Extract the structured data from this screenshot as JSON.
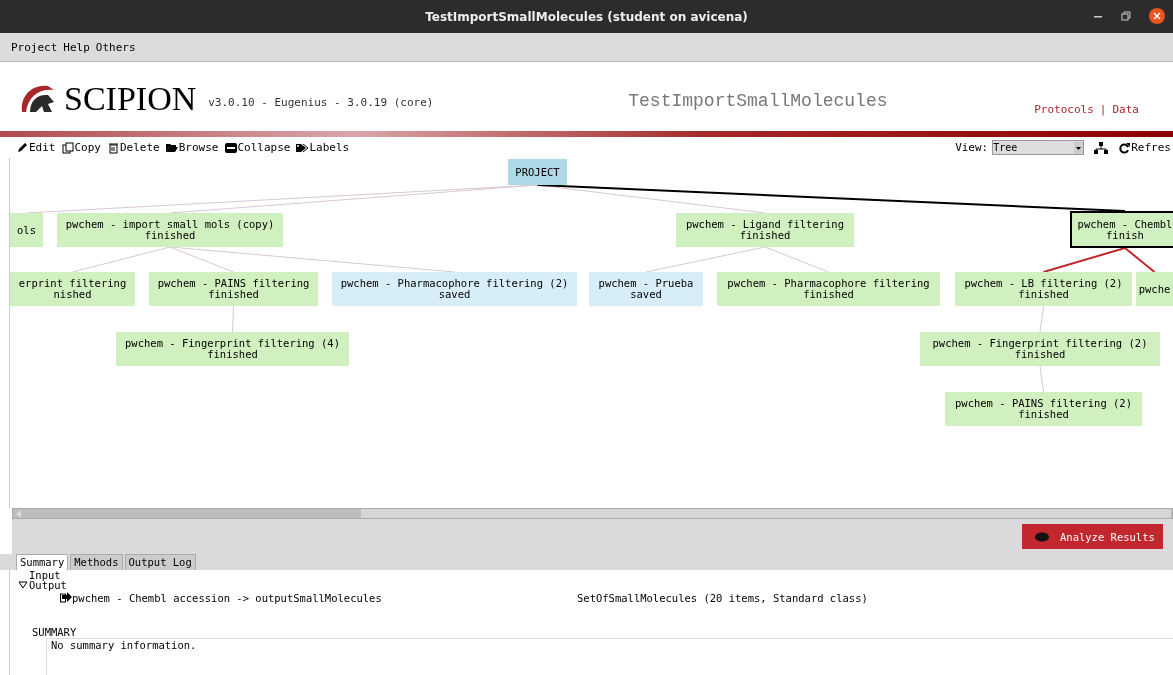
{
  "window": {
    "title": "TestImportSmallMolecules (student on avicena)"
  },
  "menu": [
    "Project",
    "Help",
    "Others"
  ],
  "header": {
    "app_name": "SCIPION",
    "version": "v3.0.10 - Eugenius - 3.0.19 (core)",
    "project_name": "TestImportSmallMolecules",
    "links": [
      "Protocols",
      "Data"
    ],
    "link_separator": "|"
  },
  "toolbar": [
    "Edit",
    "Copy",
    "Delete",
    "Browse",
    "Collapse",
    "Labels"
  ],
  "view": {
    "label": "View:",
    "value": "Tree"
  },
  "refresh": "Refres",
  "graph": {
    "root": {
      "label": "PROJECT",
      "color": "#add8e6",
      "selected": false,
      "children": [
        {
          "label": "ols",
          "color": "#d0f0c0",
          "selected": false
        },
        {
          "label": "pwchem - import small mols (copy)",
          "status": "finished",
          "color": "#d0f0c0",
          "selected": false,
          "children": [
            {
              "label": "erprint filtering",
              "status": "nished",
              "color": "#d0f0c0",
              "selected": false
            },
            {
              "label": "pwchem - PAINS filtering",
              "status": "finished",
              "color": "#d0f0c0",
              "selected": false,
              "children": [
                {
                  "label": "pwchem - Fingerprint filtering (4)",
                  "status": "finished",
                  "color": "#d0f0c0",
                  "selected": false
                }
              ]
            },
            {
              "label": "pwchem - Pharmacophore filtering (2)",
              "status": "saved",
              "color": "#d7eef9",
              "selected": false
            }
          ]
        },
        {
          "label": "pwchem - Ligand filtering",
          "status": "finished",
          "color": "#d0f0c0",
          "selected": false,
          "children": [
            {
              "label": "pwchem - Prueba",
              "status": "saved",
              "color": "#d7eef9",
              "selected": false
            },
            {
              "label": "pwchem - Pharmacophore filtering",
              "status": "finished",
              "color": "#d0f0c0",
              "selected": false
            }
          ]
        },
        {
          "label": "pwchem - Chembl",
          "status": "finish",
          "color": "#d0f0c0",
          "selected": true,
          "children": [
            {
              "label": "pwchem - LB filtering (2)",
              "status": "finished",
              "color": "#d0f0c0",
              "selected": false,
              "children": [
                {
                  "label": "pwchem - Fingerprint filtering (2)",
                  "status": "finished",
                  "color": "#d0f0c0",
                  "selected": false,
                  "children": [
                    {
                      "label": "pwchem - PAINS filtering (2)",
                      "status": "finished",
                      "color": "#d0f0c0",
                      "selected": false
                    }
                  ]
                }
              ]
            },
            {
              "label": "pwche",
              "color": "#d0f0c0",
              "selected": false
            }
          ]
        }
      ]
    }
  },
  "analyze_button": "Analyze Results",
  "tabs": [
    {
      "label": "Summary",
      "selected": true
    },
    {
      "label": "Methods",
      "selected": false
    },
    {
      "label": "Output Log",
      "selected": false
    }
  ],
  "io_tree": [
    {
      "label": "Input"
    },
    {
      "label": "Output",
      "expanded": true,
      "children": [
        {
          "label": "pwchem - Chembl accession -> outputSmallMolecules",
          "info": "SetOfSmallMolecules (20 items, Standard class)"
        }
      ]
    }
  ],
  "summary": {
    "heading": "SUMMARY",
    "text": "No summary information."
  }
}
